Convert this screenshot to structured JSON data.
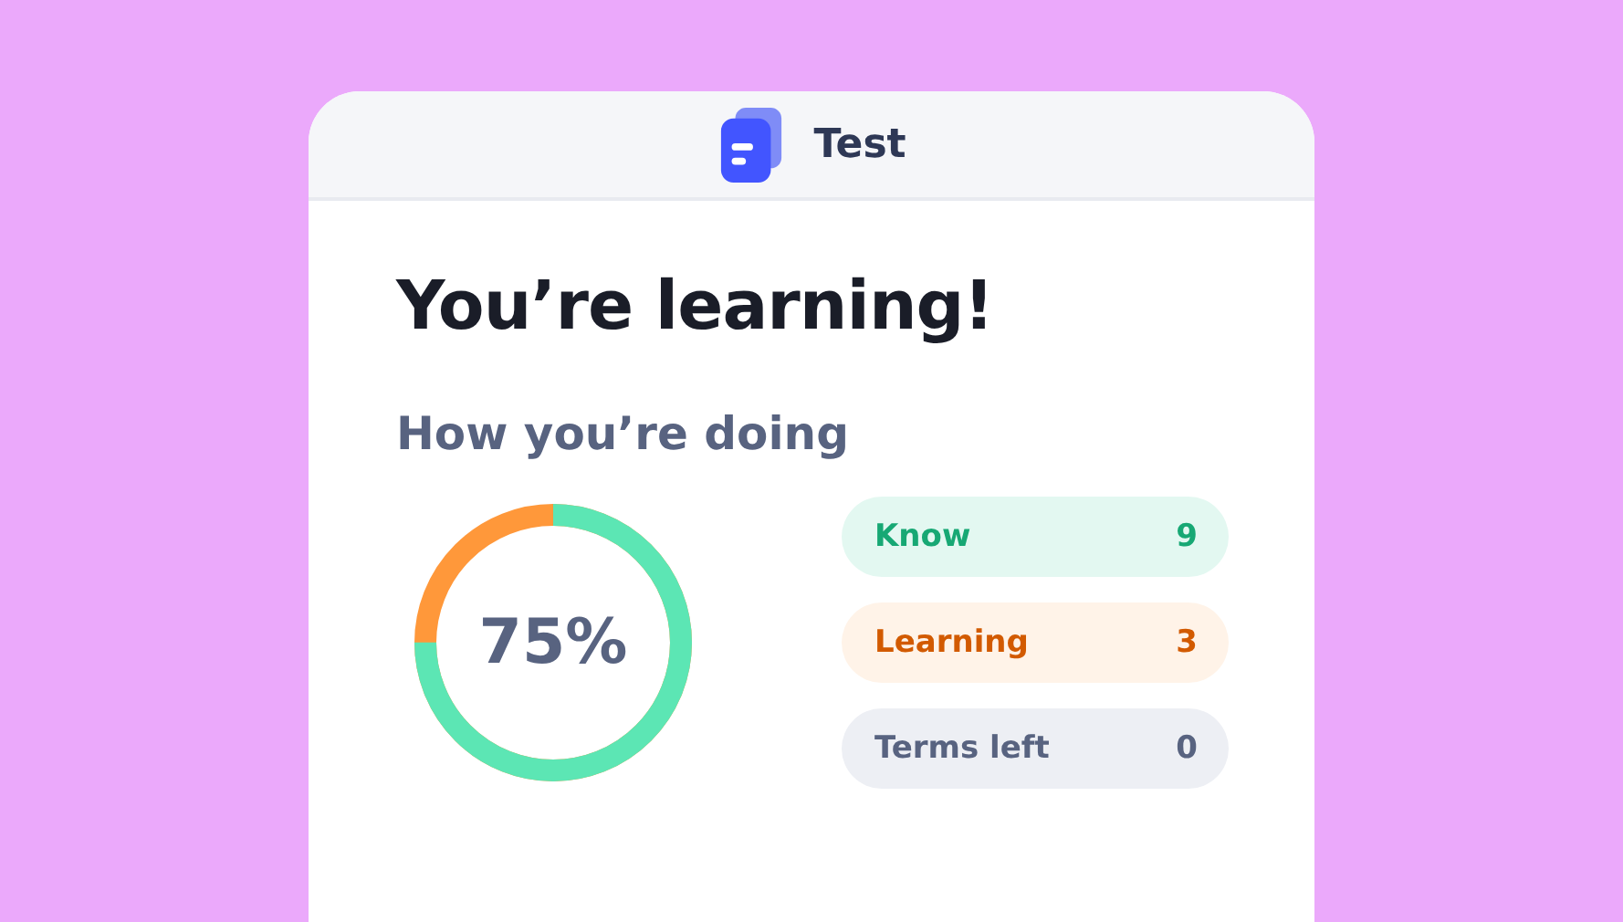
{
  "header": {
    "title": "Test"
  },
  "heading": "You’re learning!",
  "subheading": "How you’re doing",
  "progress": {
    "level": 0.75,
    "label": "75%"
  },
  "stats": [
    {
      "kind": "know",
      "label": "Know",
      "count": "9"
    },
    {
      "kind": "learning",
      "label": "Learning",
      "count": "3"
    },
    {
      "kind": "remaining",
      "label": "Terms left",
      "count": "0"
    }
  ]
}
